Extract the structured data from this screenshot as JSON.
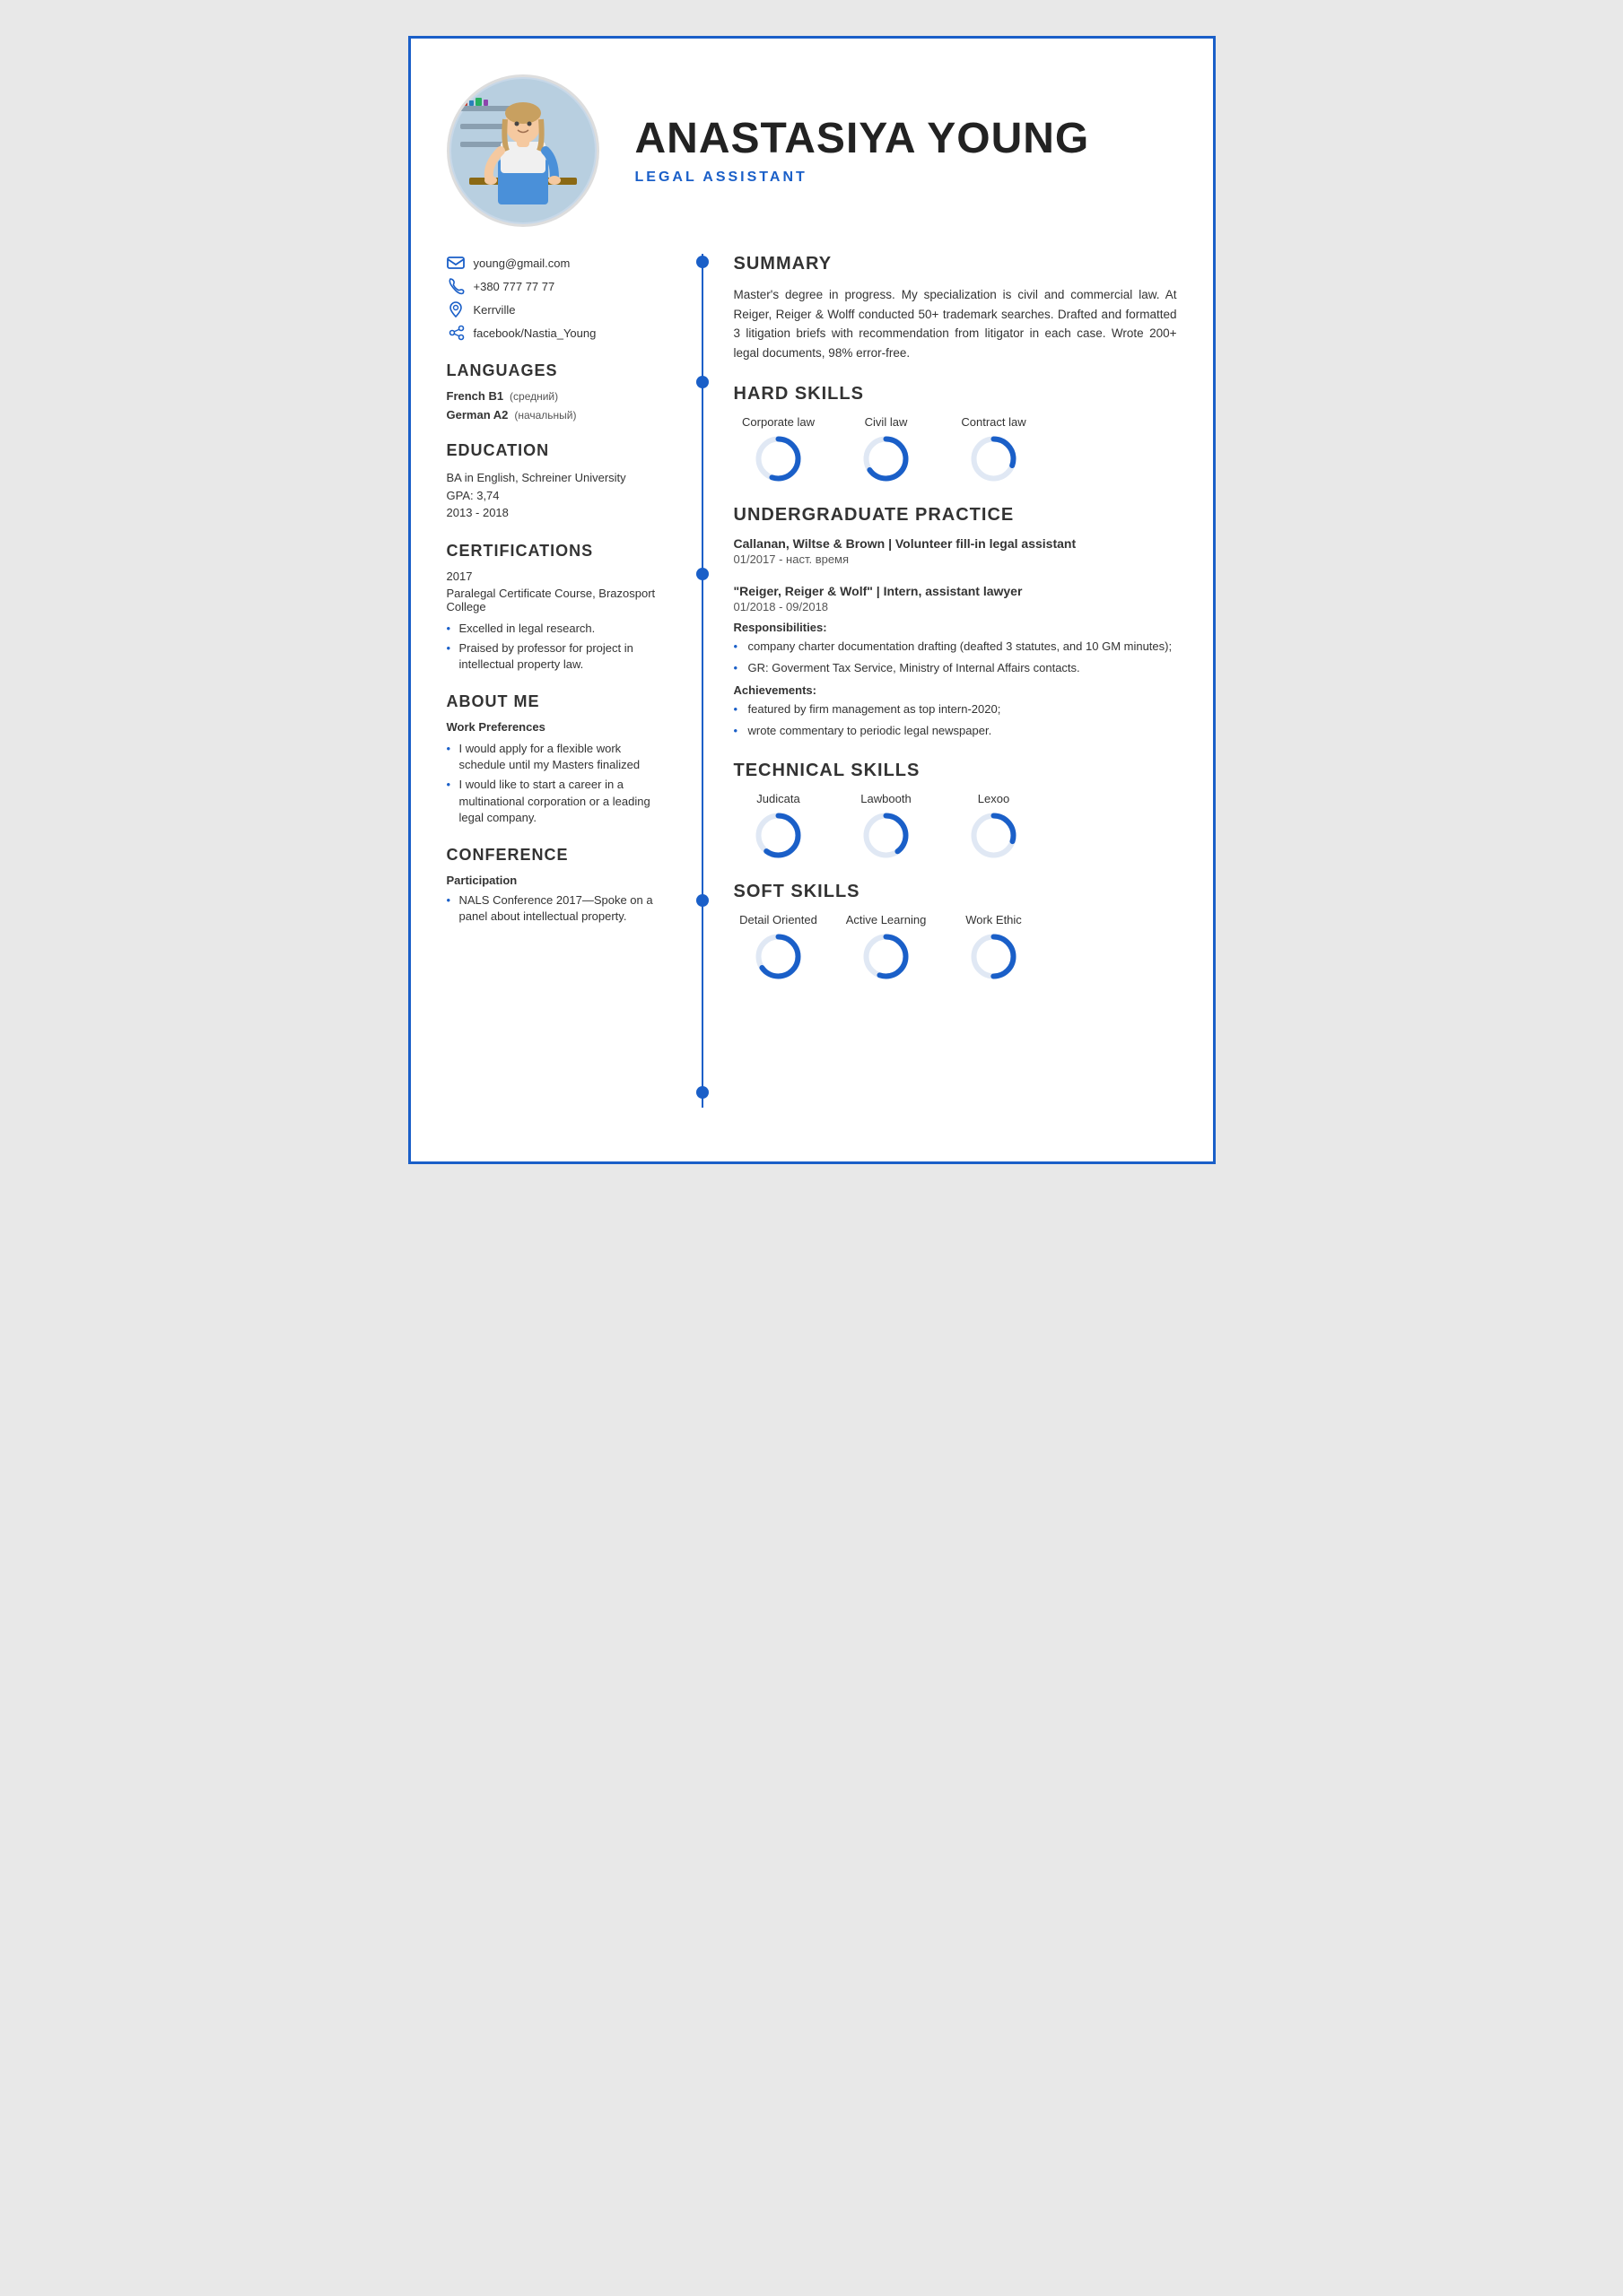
{
  "resume": {
    "name": "ANASTASIYA YOUNG",
    "title": "LEGAL ASSISTANT",
    "contact": {
      "email": "young@gmail.com",
      "phone": "+380 777 77 77",
      "location": "Kerrville",
      "social": "facebook/Nastia_Young"
    },
    "languages": {
      "title": "LANGUAGES",
      "items": [
        {
          "name": "French",
          "level": "B1",
          "note": "(средний)"
        },
        {
          "name": "German",
          "level": "A2",
          "note": "(начальный)"
        }
      ]
    },
    "education": {
      "title": "EDUCATION",
      "degree": "BA in English, Schreiner University",
      "gpa": "GPA: 3,74",
      "years": "2013 - 2018"
    },
    "certifications": {
      "title": "CERTIFICATIONS",
      "year": "2017",
      "name": "Paralegal Certificate Course, Brazosport College",
      "bullets": [
        "Excelled in legal research.",
        "Praised by professor for project in intellectual property law."
      ]
    },
    "about": {
      "title": "ABOUT ME",
      "subtitle": "Work Preferences",
      "bullets": [
        "I would apply for a flexible work schedule until my Masters finalized",
        "I would like to start a career in a multinational corporation or a leading legal company."
      ]
    },
    "conference": {
      "title": "CONFERENCE",
      "subtitle": "Participation",
      "bullets": [
        "NALS Conference 2017—Spoke on a panel about intellectual property."
      ]
    },
    "summary": {
      "title": "SUMMARY",
      "text": "Master's degree in progress. My specialization is civil and commercial law. At Reiger, Reiger & Wolff conducted 50+ trademark searches. Drafted and formatted 3 litigation briefs with recommendation from litigator in each case. Wrote 200+ legal documents, 98% error-free."
    },
    "hard_skills": {
      "title": "HARD SKILLS",
      "skills": [
        {
          "label": "Corporate law",
          "pct": 55
        },
        {
          "label": "Civil law",
          "pct": 65
        },
        {
          "label": "Contract law",
          "pct": 30
        }
      ]
    },
    "undergraduate": {
      "title": "UNDERGRADUATE PRACTICE",
      "entries": [
        {
          "org": "Callanan, Wiltse & Brown | Volunteer fill-in legal assistant",
          "dates": "01/2017 - наст. время",
          "responsibilities": [],
          "achievements": []
        },
        {
          "org": "\"Reiger, Reiger & Wolf\" | Intern, assistant lawyer",
          "dates": "01/2018 - 09/2018",
          "responsibilities_label": "Responsibilities:",
          "responsibilities": [
            "company charter documentation drafting (deafted 3 statutes, and 10 GM minutes);",
            "GR: Goverment Tax Service, Ministry of Internal Affairs contacts."
          ],
          "achievements_label": "Achievements:",
          "achievements": [
            "featured by firm management as top intern-2020;",
            "wrote commentary to periodic legal newspaper."
          ]
        }
      ]
    },
    "technical_skills": {
      "title": "TECHNICAL SKILLS",
      "skills": [
        {
          "label": "Judicata",
          "pct": 60
        },
        {
          "label": "Lawbooth",
          "pct": 40
        },
        {
          "label": "Lexoo",
          "pct": 30
        }
      ]
    },
    "soft_skills": {
      "title": "SOFT SKILLS",
      "skills": [
        {
          "label": "Detail Oriented",
          "pct": 65
        },
        {
          "label": "Active Learning",
          "pct": 55
        },
        {
          "label": "Work Ethic",
          "pct": 50
        }
      ]
    }
  }
}
